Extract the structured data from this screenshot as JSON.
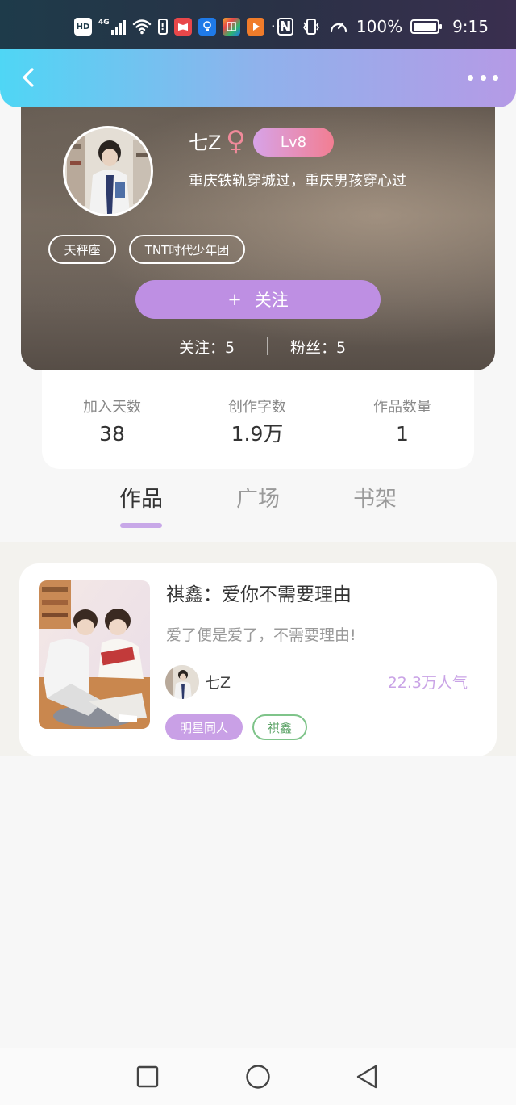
{
  "status_bar": {
    "network_badge": "HD",
    "network_type": "4G",
    "more_indicator": "···",
    "battery": "100%",
    "time": "9:15",
    "app_icons": [
      {
        "name": "reader-app-icon",
        "color": "#e8474a"
      },
      {
        "name": "bulb-app-icon",
        "color": "#1f7ae8"
      },
      {
        "name": "grid-app-icon",
        "color": "#f0b02c"
      },
      {
        "name": "play-app-icon",
        "color": "#f07c2a"
      }
    ]
  },
  "nav": {
    "back_icon": "chevron-left-icon",
    "more_icon": "more-dots-icon"
  },
  "profile": {
    "username": "七Z",
    "gender_symbol": "♀",
    "level": "Lv8",
    "bio": "重庆铁轨穿城过，重庆男孩穿心过",
    "tags": [
      "天秤座",
      "TNT时代少年团"
    ],
    "follow_button": {
      "icon": "+",
      "label": "关注"
    },
    "following_label": "关注：",
    "following_count": "5",
    "followers_label": "粉丝：",
    "followers_count": "5"
  },
  "stats": [
    {
      "label": "加入天数",
      "value": "38"
    },
    {
      "label": "创作字数",
      "value": "1.9万"
    },
    {
      "label": "作品数量",
      "value": "1"
    }
  ],
  "tabs": [
    {
      "label": "作品",
      "active": true
    },
    {
      "label": "广场",
      "active": false
    },
    {
      "label": "书架",
      "active": false
    }
  ],
  "works": [
    {
      "title": "祺鑫：爱你不需要理由",
      "description": "爱了便是爱了，不需要理由!",
      "author": "七Z",
      "popularity": "22.3万人气",
      "category": "明星同人",
      "tag": "祺鑫"
    }
  ],
  "colors": {
    "accent_purple": "#be8fe3",
    "nav_gradient_start": "#4fd6f5",
    "nav_gradient_end": "#b59ae6",
    "popularity": "#c9a3e6",
    "tag_green": "#7fc48a"
  }
}
